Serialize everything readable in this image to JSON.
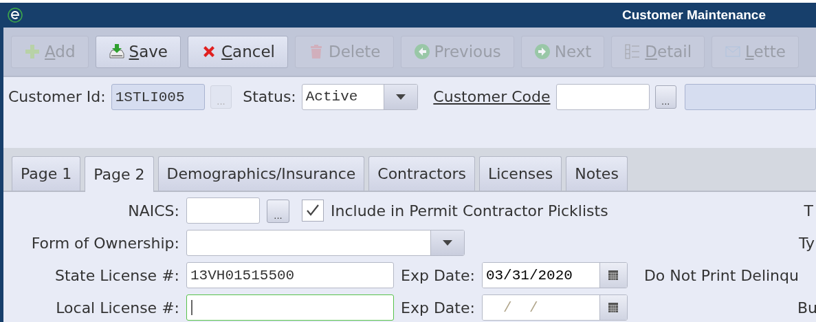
{
  "window": {
    "title": "Customer Maintenance"
  },
  "toolbar": {
    "buttons": [
      {
        "label": "Add",
        "kind": "add",
        "disabled": true,
        "mnemonic": true
      },
      {
        "label": "Save",
        "kind": "save",
        "disabled": false,
        "mnemonic": true
      },
      {
        "label": "Cancel",
        "kind": "cancel",
        "disabled": false,
        "mnemonic": true
      },
      {
        "label": "Delete",
        "kind": "delete",
        "disabled": true,
        "mnemonic": false
      },
      {
        "label": "Previous",
        "kind": "previous",
        "disabled": true,
        "mnemonic": false
      },
      {
        "label": "Next",
        "kind": "next",
        "disabled": true,
        "mnemonic": false
      },
      {
        "label": "Detail",
        "kind": "detail",
        "disabled": true,
        "mnemonic": true
      },
      {
        "label": "Lette",
        "kind": "letters",
        "disabled": true,
        "mnemonic": true
      }
    ]
  },
  "header": {
    "customer_id": {
      "label": "Customer Id:",
      "value": "1STLI005",
      "lookup_disabled": true,
      "lookup_label": "..."
    },
    "status": {
      "label": "Status:",
      "value": "Active"
    },
    "customer_code": {
      "label": "Customer Code",
      "lookup_disabled": false,
      "lookup_label": "..."
    }
  },
  "tabs": [
    {
      "label": "Page 1",
      "selected": false
    },
    {
      "label": "Page 2",
      "selected": true
    },
    {
      "label": "Demographics/Insurance",
      "selected": false
    },
    {
      "label": "Contractors",
      "selected": false
    },
    {
      "label": "Licenses",
      "selected": false
    },
    {
      "label": "Notes",
      "selected": false
    }
  ],
  "page": {
    "naics": {
      "label": "NAICS:",
      "lookup_label": "..."
    },
    "include_in_picklists": {
      "label": "Include in Permit Contractor Picklists",
      "checked": true
    },
    "form_of_ownership": {
      "label": "Form of Ownership:"
    },
    "state_license": {
      "label": "State License #:",
      "value": "13VH01515500",
      "focused": false,
      "exp_label": "Exp Date:",
      "exp_value": "03/31/2020"
    },
    "local_license": {
      "label": "Local License #:",
      "focused": true,
      "exp_label": "Exp Date:",
      "exp_placeholder": "  /  /"
    },
    "right_labels": [
      "T",
      "Ty",
      "Do Not Print Delinqu",
      "Bu"
    ]
  }
}
